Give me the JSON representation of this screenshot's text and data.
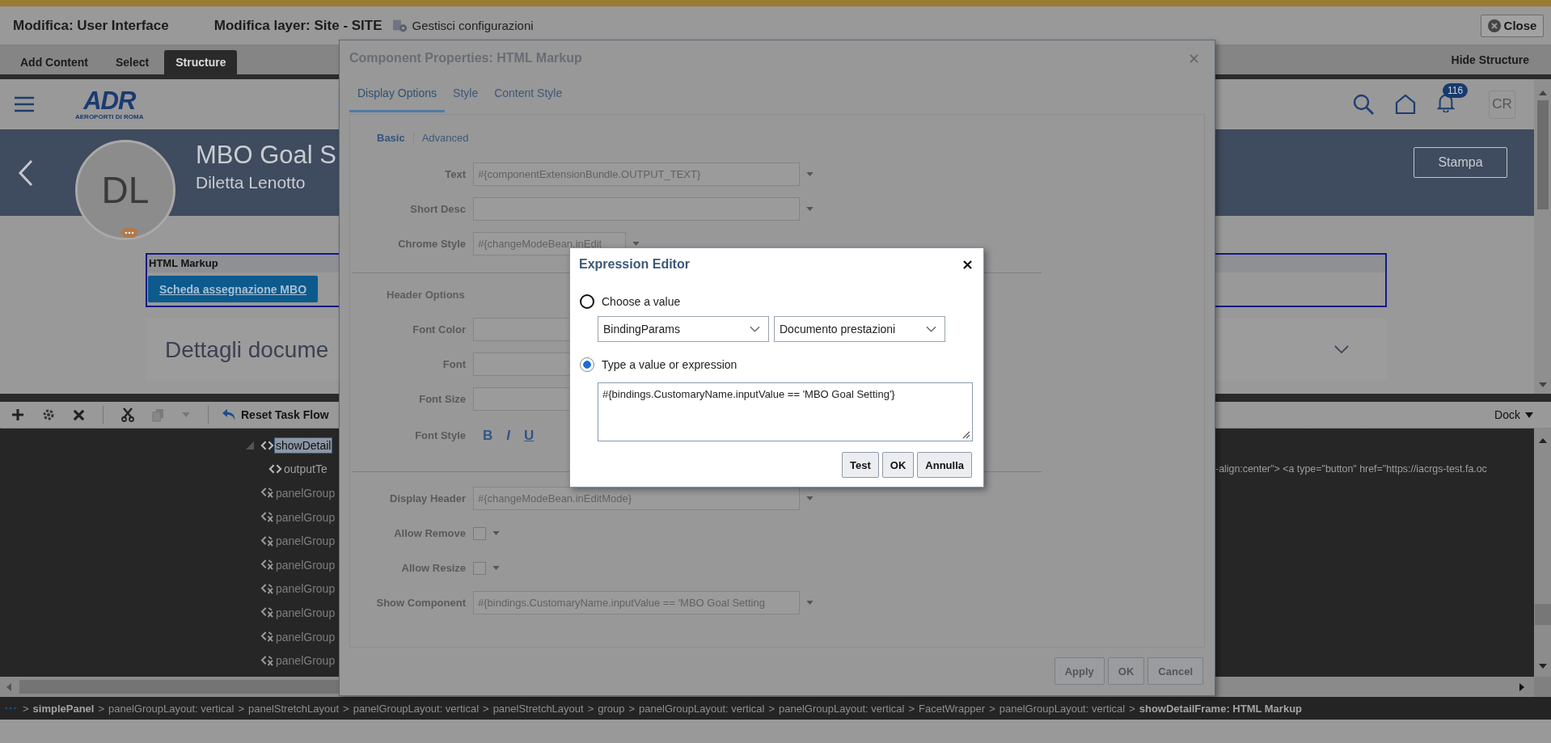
{
  "editor_bar": {
    "title": "Modifica: User Interface",
    "layer": "Modifica layer: Site - SITE",
    "configurations_link": "Gestisci configurazioni",
    "close_button": "Close"
  },
  "composer_tabs": [
    {
      "label": "Add Content",
      "selected": false
    },
    {
      "label": "Select",
      "selected": false
    },
    {
      "label": "Structure",
      "selected": true
    }
  ],
  "hide_structure": "Hide Structure",
  "app_header": {
    "logo": "ADR",
    "logo_tagline": "AEROPORTI DI ROMA",
    "notification_count": "116",
    "user_initials": "CR"
  },
  "banner": {
    "avatar_initials": "DL",
    "title": "MBO Goal S",
    "subtitle": "Diletta Lenotto",
    "print_button": "Stampa"
  },
  "html_markup": {
    "header": "HTML Markup",
    "button": "Scheda assegnazione MBO"
  },
  "details_section": {
    "title": "Dettagli docume"
  },
  "structure_toolbar": {
    "reset_button": "Reset Task Flow",
    "dock_menu": "Dock"
  },
  "structure_tree": [
    {
      "label": "showDetail",
      "kind": "shown",
      "selected": true,
      "expanded": true,
      "children": [
        {
          "label": "outputTe",
          "kind": "shown",
          "selected": false,
          "source": "-align:center\"> <a type=\"button\" href=\"https://iacrgs-test.fa.oc"
        }
      ]
    },
    {
      "label": "panelGroup",
      "kind": "hidden",
      "selected": false
    },
    {
      "label": "panelGroup",
      "kind": "hidden",
      "selected": false
    },
    {
      "label": "panelGroup",
      "kind": "hidden",
      "selected": false
    },
    {
      "label": "panelGroup",
      "kind": "hidden",
      "selected": false
    },
    {
      "label": "panelGroup",
      "kind": "hidden",
      "selected": false
    },
    {
      "label": "panelGroup",
      "kind": "hidden",
      "selected": false
    },
    {
      "label": "panelGroup",
      "kind": "hidden",
      "selected": false
    },
    {
      "label": "panelGroup",
      "kind": "hidden",
      "selected": false
    }
  ],
  "breadcrumb": {
    "separator": ">",
    "items": [
      {
        "text": "simplePanel",
        "bold": true
      },
      {
        "text": "panelGroupLayout: vertical",
        "bold": false
      },
      {
        "text": "panelStretchLayout",
        "bold": false
      },
      {
        "text": "panelGroupLayout: vertical",
        "bold": false
      },
      {
        "text": "panelStretchLayout",
        "bold": false
      },
      {
        "text": "group",
        "bold": false
      },
      {
        "text": "panelGroupLayout: vertical",
        "bold": false
      },
      {
        "text": "panelGroupLayout: vertical",
        "bold": false
      },
      {
        "text": "FacetWrapper",
        "bold": false
      },
      {
        "text": "panelGroupLayout: vertical",
        "bold": false
      },
      {
        "text": "showDetailFrame: HTML Markup",
        "bold": true
      }
    ]
  },
  "properties_dialog": {
    "title": "Component Properties: HTML Markup",
    "tabs": [
      {
        "label": "Display Options",
        "selected": true
      },
      {
        "label": "Style",
        "selected": false
      },
      {
        "label": "Content Style",
        "selected": false
      }
    ],
    "subtabs": [
      {
        "label": "Basic",
        "selected": true
      },
      {
        "label": "Advanced",
        "selected": false
      }
    ],
    "sections": [
      {
        "fields": [
          {
            "kind": "text",
            "label": "Text",
            "value": "#{componentExtensionBundle.OUTPUT_TEXT}",
            "dropdown": true
          },
          {
            "kind": "text",
            "label": "Short Desc",
            "dropdown": true
          },
          {
            "kind": "short",
            "label": "Chrome Style",
            "value": "#{changeModeBean.inEdit",
            "dropdown": true
          }
        ]
      },
      {
        "heading": "Header Options",
        "fields": [
          {
            "kind": "text",
            "label": "Font Color",
            "dropdown": false
          },
          {
            "kind": "text",
            "label": "Font",
            "dropdown": false
          },
          {
            "kind": "text",
            "label": "Font Size",
            "dropdown": false
          },
          {
            "kind": "font_style",
            "label": "Font Style",
            "buttons": [
              "B",
              "I",
              "U"
            ]
          }
        ]
      },
      {
        "fields": [
          {
            "kind": "text",
            "label": "Display Header",
            "value": "#{changeModeBean.inEditMode}",
            "dropdown": true
          },
          {
            "kind": "checkbox",
            "label": "Allow Remove",
            "checked": false
          },
          {
            "kind": "checkbox",
            "label": "Allow Resize",
            "checked": false
          },
          {
            "kind": "text",
            "label": "Show Component",
            "value": "#{bindings.CustomaryName.inputValue == 'MBO Goal Setting",
            "dropdown": true
          }
        ]
      }
    ],
    "buttons": [
      "Apply",
      "OK",
      "Cancel"
    ]
  },
  "expression_editor": {
    "title": "Expression Editor",
    "options": [
      {
        "label": "Choose a value",
        "selected": false
      },
      {
        "label": "Type a value or expression",
        "selected": true
      }
    ],
    "selects": [
      "BindingParams",
      "Documento prestazioni"
    ],
    "expression": "#{bindings.CustomaryName.inputValue == 'MBO Goal Setting'}",
    "buttons": [
      "Test",
      "OK",
      "Annulla"
    ]
  }
}
